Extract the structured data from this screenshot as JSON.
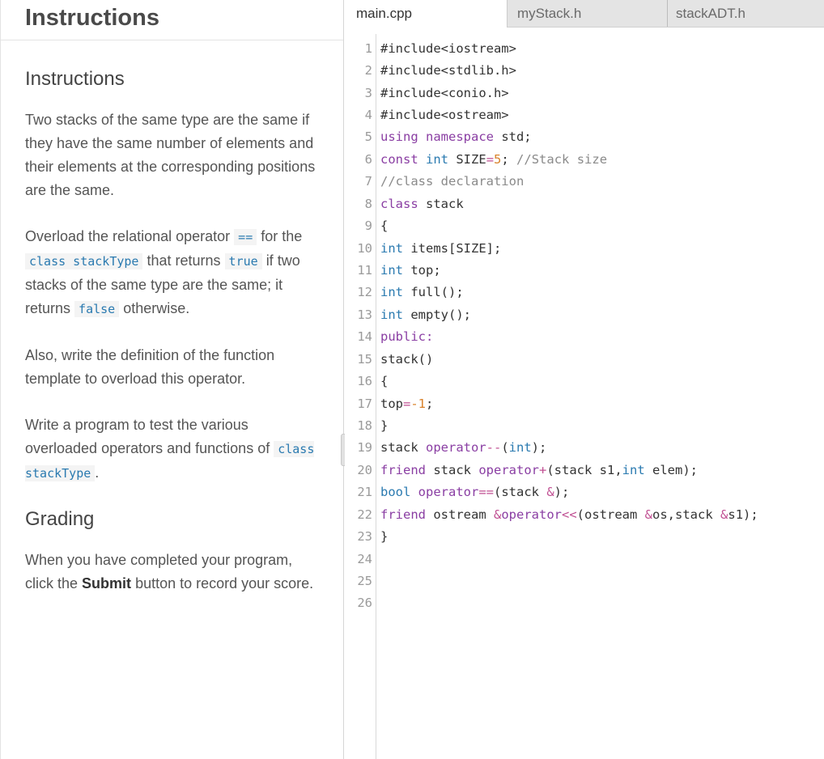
{
  "instructions_panel": {
    "header_title": "Instructions",
    "section_title": "Instructions",
    "paragraph1": "Two stacks of the same type are the same if they have the same number of elements and their elements at the corresponding positions are the same.",
    "p2_text1": "Overload the relational operator",
    "p2_code1": "==",
    "p2_text2": "for the",
    "p2_code2": "class stackType",
    "p2_text3": "that returns",
    "p2_code3": "true",
    "p2_text4": "if two stacks of the same type are the same; it returns",
    "p2_code4": "false",
    "p2_text5": "otherwise.",
    "paragraph3": "Also, write the definition of the function template to overload this operator.",
    "p4_text1": "Write a program to test the various overloaded operators and functions of",
    "p4_code1": "class stackType",
    "p4_text2": ".",
    "grading_title": "Grading",
    "g_text1": "When you have completed your program, click the",
    "g_bold": "Submit",
    "g_text2": "button to record your score."
  },
  "editor": {
    "tabs": [
      "main.cpp",
      "myStack.h",
      "stackADT.h"
    ],
    "active_tab": "main.cpp",
    "line_numbers": [
      "1",
      "2",
      "3",
      "4",
      "5",
      "6",
      "7",
      "8",
      "9",
      "10",
      "11",
      "12",
      "13",
      "14",
      "15",
      "16",
      "17",
      "18",
      "19",
      "20",
      "21",
      "22",
      "23",
      "24",
      "25",
      "26"
    ],
    "code": {
      "l1": "#include<iostream>",
      "l2": "#include<stdlib.h>",
      "l3": "#include<conio.h>",
      "l4": "#include<ostream>",
      "l5_kw": "using namespace",
      "l5_rest": " std;",
      "l6_kw": "const",
      "l6_ty": "int",
      "l6_name": " SIZE",
      "l6_eq": "=",
      "l6_num": "5",
      "l6_semi": ";",
      "l6_cm": " //Stack size",
      "l7_cm": "//class declaration",
      "l8_kw": "class",
      "l8_rest": " stack",
      "l9": "{",
      "l10_ty": "int",
      "l10_rest": " items[SIZE];",
      "l11_ty": "int",
      "l11_rest": " top;",
      "l12_ty": "int",
      "l12_rest": " full();",
      "l13_ty": "int",
      "l13_rest": " empty();",
      "l14_kw": "public:",
      "l15": "stack()",
      "l16": "{",
      "l17_a": "top",
      "l17_eq": "=",
      "l17_num": "-1",
      "l17_semi": ";",
      "l18": "}",
      "l19_a": "stack ",
      "l19_kw": "operator",
      "l19_op": "--",
      "l19_b": "(",
      "l19_ty": "int",
      "l19_c": ");",
      "l20_kw": "friend",
      "l20_a": " stack ",
      "l20_kw2": "operator",
      "l20_op": "+",
      "l20_b": "(stack s1,",
      "l20_ty": "int",
      "l20_c": " elem);",
      "l21_ty": "bool",
      "l21_sp": " ",
      "l21_kw": "operator",
      "l21_op": "==",
      "l21_a": "(stack ",
      "l21_op2": "&",
      "l21_b": ");",
      "l22_kw": "friend",
      "l22_a": " ostream ",
      "l22_op": "&",
      "l22_kw2": "operator",
      "l22_op2": "<<",
      "l22_b": "(ostream ",
      "l22_op3": "&",
      "l22_c": "os,stack ",
      "l22_op4": "&",
      "l22_d": "s1);",
      "l23": "}"
    }
  }
}
